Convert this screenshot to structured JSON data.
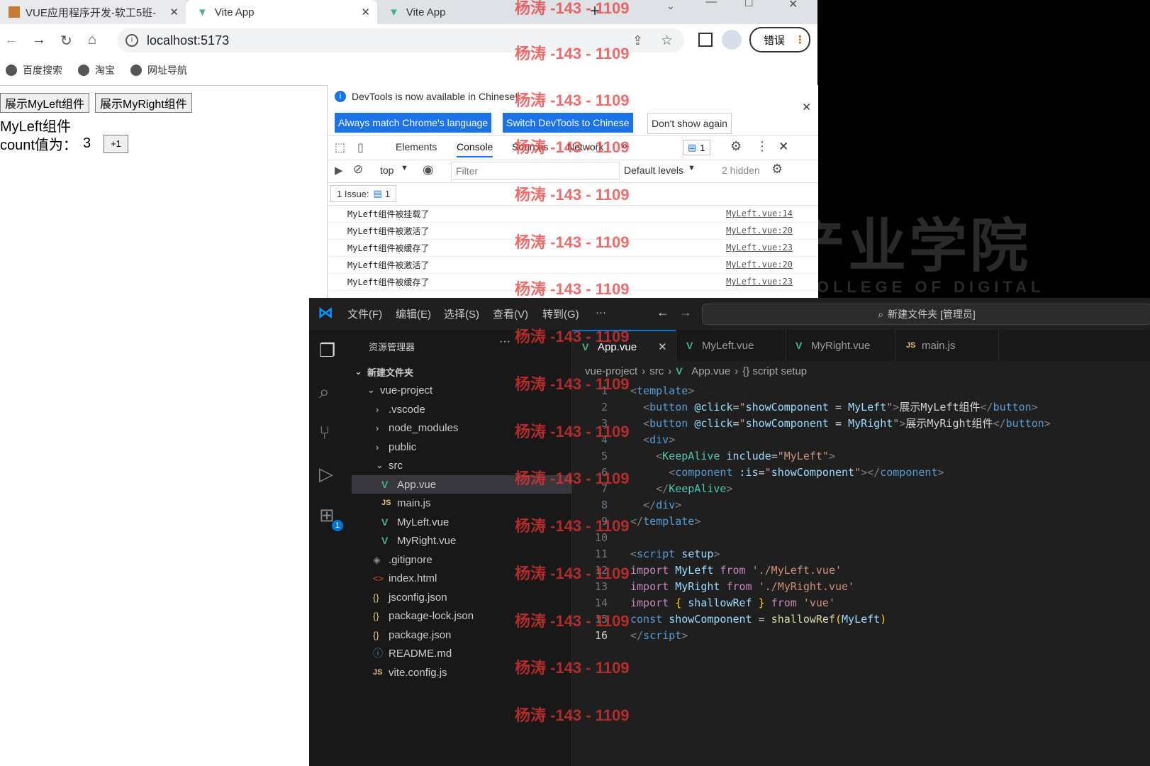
{
  "browser": {
    "tabs": [
      {
        "title": "VUE应用程序开发-软工5班-",
        "active": false
      },
      {
        "title": "Vite App",
        "active": true
      },
      {
        "title": "Vite App",
        "active": false
      }
    ],
    "url": "localhost:5173",
    "error_button": "错误",
    "bookmarks": [
      "百度搜索",
      "淘宝",
      "网址导航"
    ]
  },
  "page": {
    "btn_left": "展示MyLeft组件",
    "btn_right": "展示MyRight组件",
    "component_title": "MyLeft组件",
    "count_label": "count值为：",
    "count_value": "3",
    "plus_label": "+1"
  },
  "devtools": {
    "notice": "DevTools is now available in Chinese!",
    "btn_match": "Always match Chrome's language",
    "btn_switch": "Switch DevTools to Chinese",
    "btn_dont": "Don't show again",
    "tabs": [
      "Elements",
      "Console",
      "Sources",
      "Network"
    ],
    "active_tab": "Console",
    "issues_badge": "1",
    "context": "top",
    "filter_placeholder": "Filter",
    "levels": "Default levels",
    "hidden": "2 hidden",
    "issue_label": "1 Issue:",
    "issue_count": "1",
    "logs": [
      {
        "msg": "MyLeft组件被挂载了",
        "src": "MyLeft.vue:14"
      },
      {
        "msg": "MyLeft组件被激活了",
        "src": "MyLeft.vue:20"
      },
      {
        "msg": "MyLeft组件被缓存了",
        "src": "MyLeft.vue:23"
      },
      {
        "msg": "MyLeft组件被激活了",
        "src": "MyLeft.vue:20"
      },
      {
        "msg": "MyLeft组件被缓存了",
        "src": "MyLeft.vue:23"
      }
    ]
  },
  "vscode": {
    "menus": [
      "文件(F)",
      "编辑(E)",
      "选择(S)",
      "查看(V)",
      "转到(G)",
      "···"
    ],
    "search": "新建文件夹 [管理员]",
    "extensions_badge": "1",
    "explorer_title": "资源管理器",
    "folder": "新建文件夹",
    "tree": [
      "vue-project",
      ".vscode",
      "node_modules",
      "public",
      "src",
      "App.vue",
      "main.js",
      "MyLeft.vue",
      "MyRight.vue",
      ".gitignore",
      "index.html",
      "jsconfig.json",
      "package-lock.json",
      "package.json",
      "README.md",
      "vite.config.js"
    ],
    "editor_tabs": [
      "App.vue",
      "MyLeft.vue",
      "MyRight.vue",
      "main.js"
    ],
    "breadcrumb": [
      "vue-project",
      "src",
      "App.vue",
      "{} script setup"
    ],
    "line_numbers": [
      "1",
      "2",
      "3",
      "4",
      "5",
      "6",
      "7",
      "8",
      "9",
      "10",
      "11",
      "12",
      "13",
      "14",
      "15",
      "16"
    ]
  },
  "background": {
    "title": "产业学院",
    "subtitle": "COLLEGE OF DIGITAL INTELLIGENT"
  },
  "watermark": "杨涛 -143 - 1109"
}
